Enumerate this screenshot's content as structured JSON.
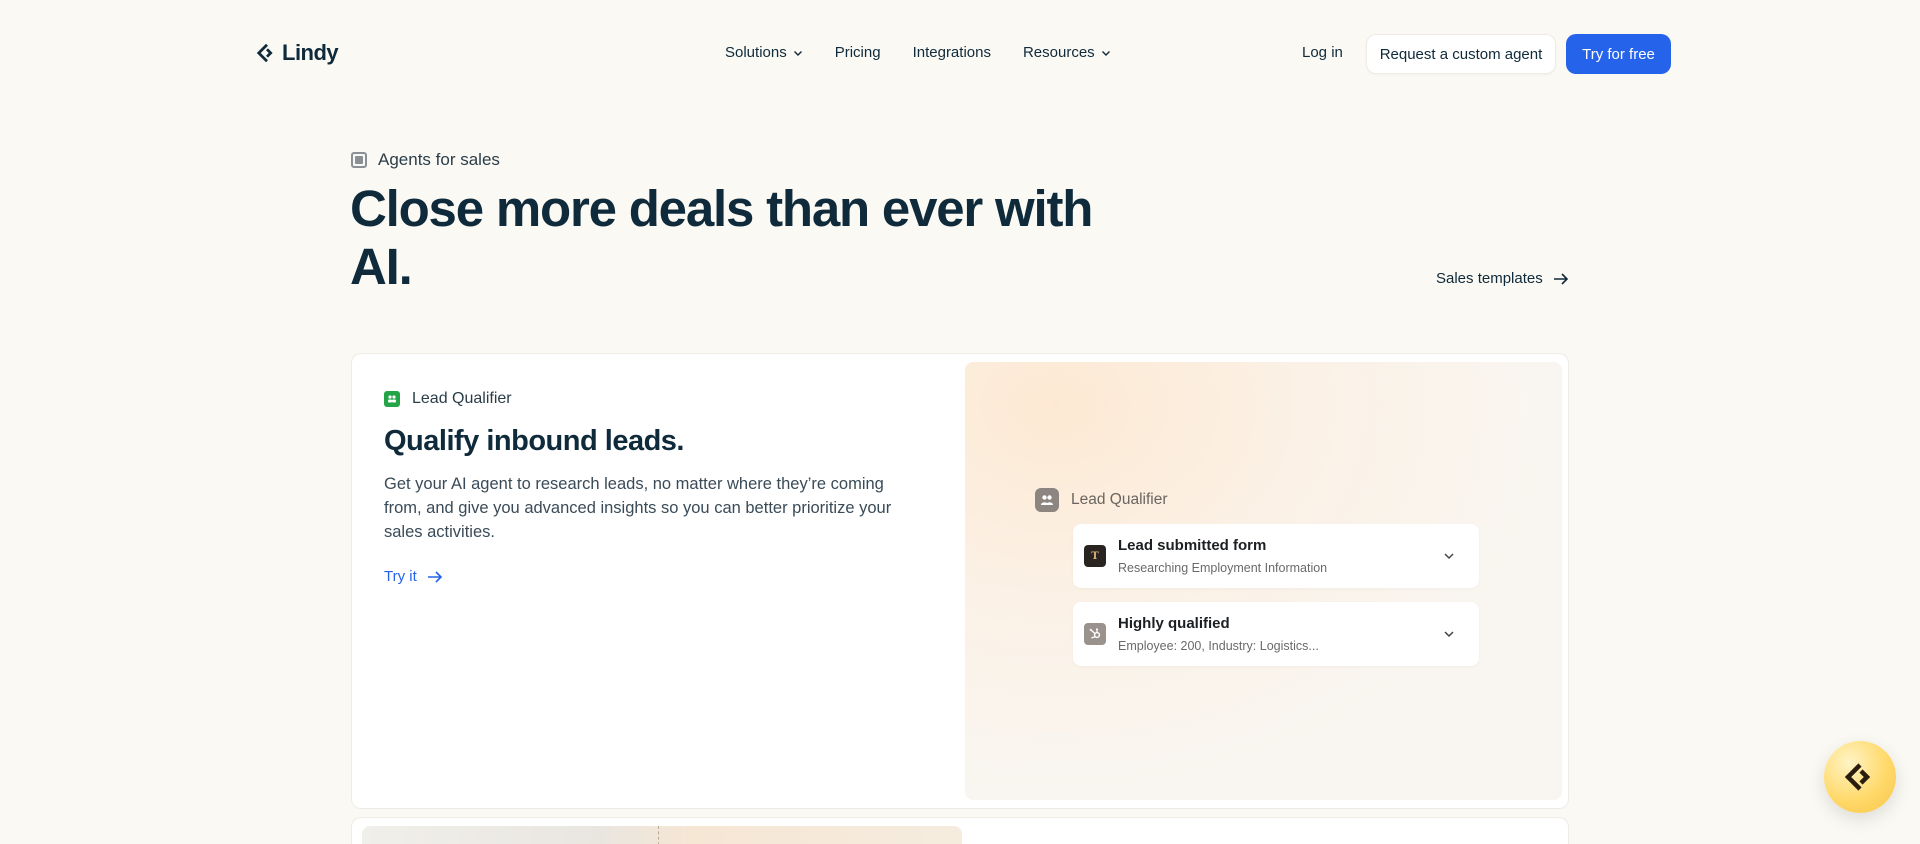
{
  "header": {
    "logo_text": "Lindy",
    "nav": [
      {
        "label": "Solutions",
        "has_dropdown": true
      },
      {
        "label": "Pricing",
        "has_dropdown": false
      },
      {
        "label": "Integrations",
        "has_dropdown": false
      },
      {
        "label": "Resources",
        "has_dropdown": true
      }
    ],
    "login_label": "Log in",
    "custom_agent_label": "Request a custom agent",
    "try_free_label": "Try for free"
  },
  "hero": {
    "eyebrow": "Agents for sales",
    "title": "Close more deals than ever with AI.",
    "templates_link": "Sales templates"
  },
  "card": {
    "tag": "Lead Qualifier",
    "title": "Qualify inbound leads.",
    "description": "Get your AI agent to research leads, no matter where they’re coming from, and give you advanced insights so you can better prioritize your sales activities.",
    "cta": "Try it",
    "preview": {
      "agent_label": "Lead Qualifier",
      "steps": [
        {
          "icon": "typeform-icon",
          "icon_letter": "T",
          "title": "Lead submitted form",
          "subtitle": "Researching Employment Information"
        },
        {
          "icon": "hubspot-icon",
          "title": "Highly qualified",
          "subtitle": "Employee: 200, Industry: Logistics..."
        }
      ]
    }
  },
  "colors": {
    "accent": "#2563eb",
    "background": "#fbf9f4",
    "heading": "#0f2a3a",
    "tag_green": "#22a447",
    "fab_yellow": "#ffd96a"
  }
}
